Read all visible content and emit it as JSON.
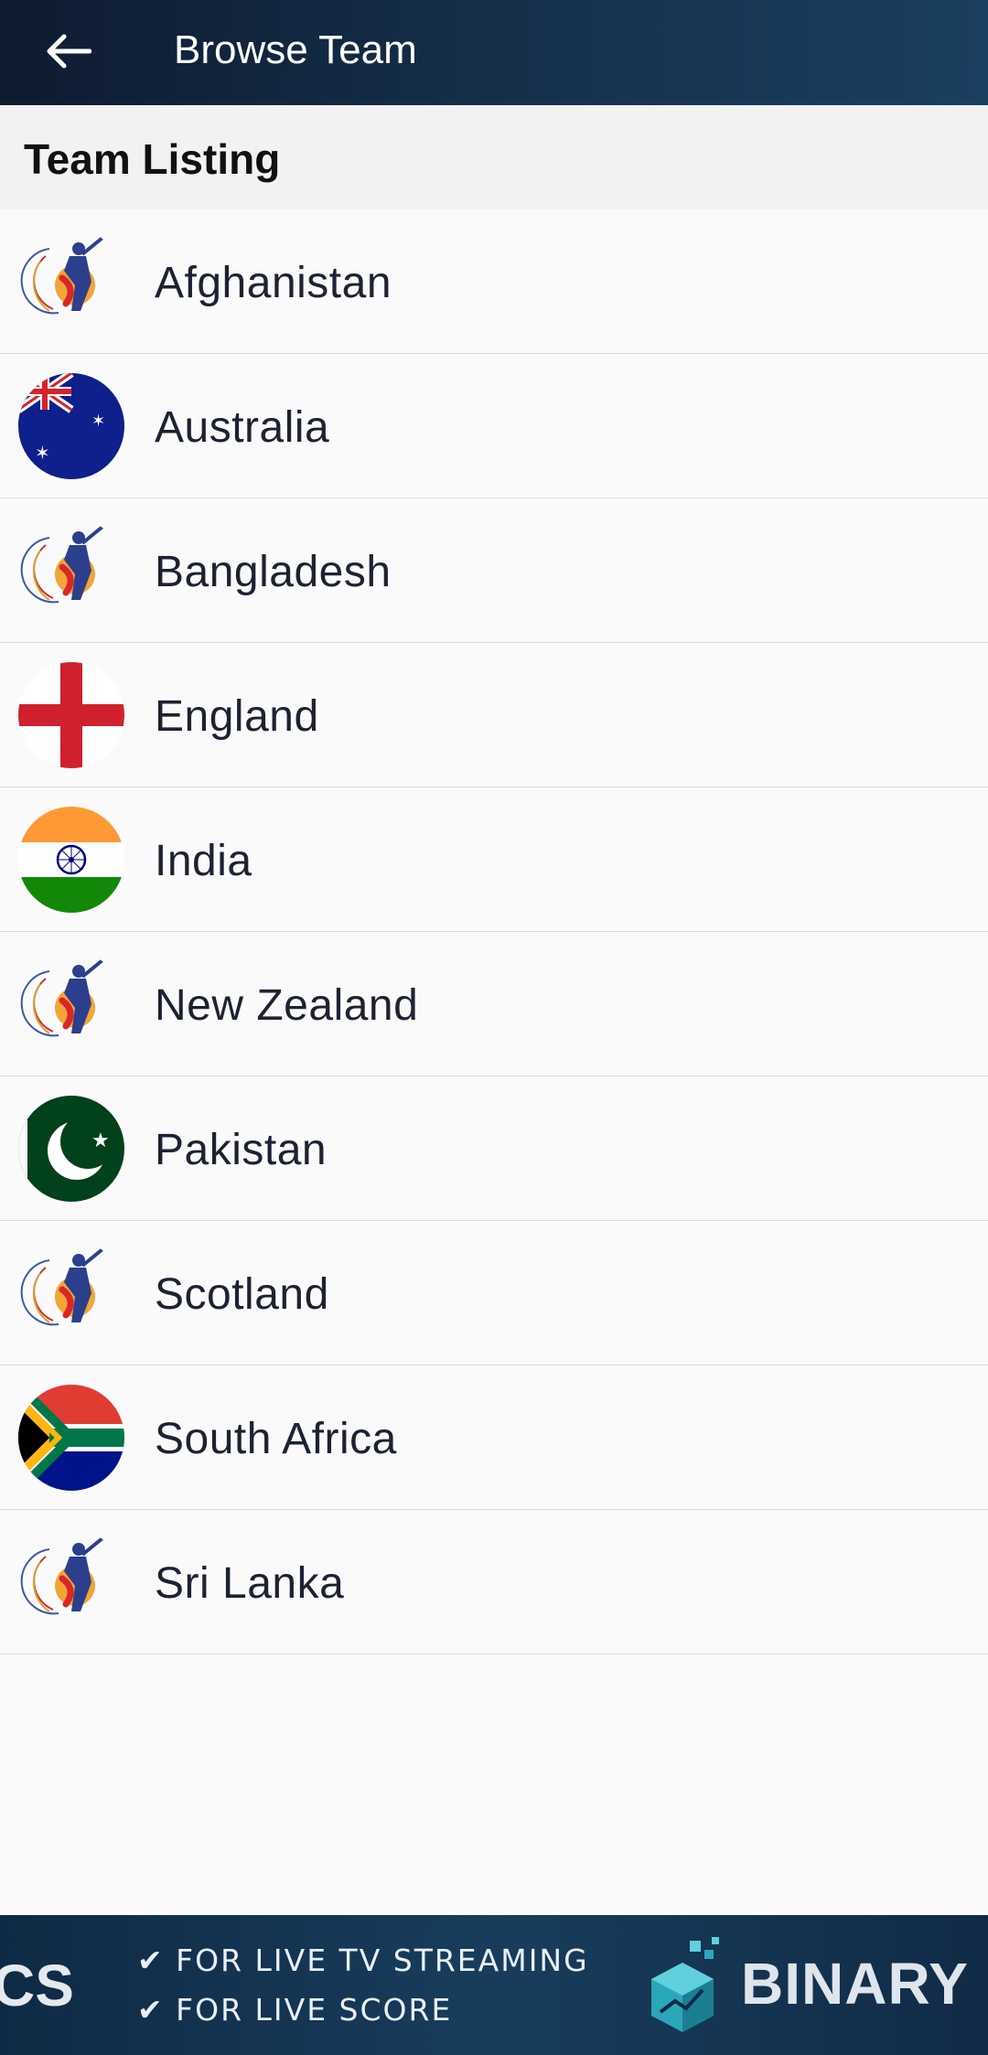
{
  "appbar": {
    "back_icon": "arrow-left-icon",
    "title": "Browse Team"
  },
  "section": {
    "title": "Team Listing"
  },
  "teams": [
    {
      "name": "Afghanistan",
      "icon": "cricket-logo-icon"
    },
    {
      "name": "Australia",
      "icon": "australia-flag-icon"
    },
    {
      "name": "Bangladesh",
      "icon": "cricket-logo-icon"
    },
    {
      "name": "England",
      "icon": "england-flag-icon"
    },
    {
      "name": "India",
      "icon": "india-flag-icon"
    },
    {
      "name": "New Zealand",
      "icon": "cricket-logo-icon"
    },
    {
      "name": "Pakistan",
      "icon": "pakistan-flag-icon"
    },
    {
      "name": "Scotland",
      "icon": "cricket-logo-icon"
    },
    {
      "name": "South Africa",
      "icon": "south-africa-flag-icon"
    },
    {
      "name": "Sri Lanka",
      "icon": "cricket-logo-icon"
    }
  ],
  "banner": {
    "left_text": "CS",
    "line1": "✔ FOR LIVE TV STREAMING",
    "line2": "✔ FOR LIVE SCORE",
    "brand": "BINARY BRIC",
    "logo_icon": "binary-bricks-cube-icon"
  },
  "colors": {
    "appbar_start": "#0e1b30",
    "appbar_end": "#1b3f60",
    "text": "#1d2233",
    "divider": "#dcdcdc"
  }
}
